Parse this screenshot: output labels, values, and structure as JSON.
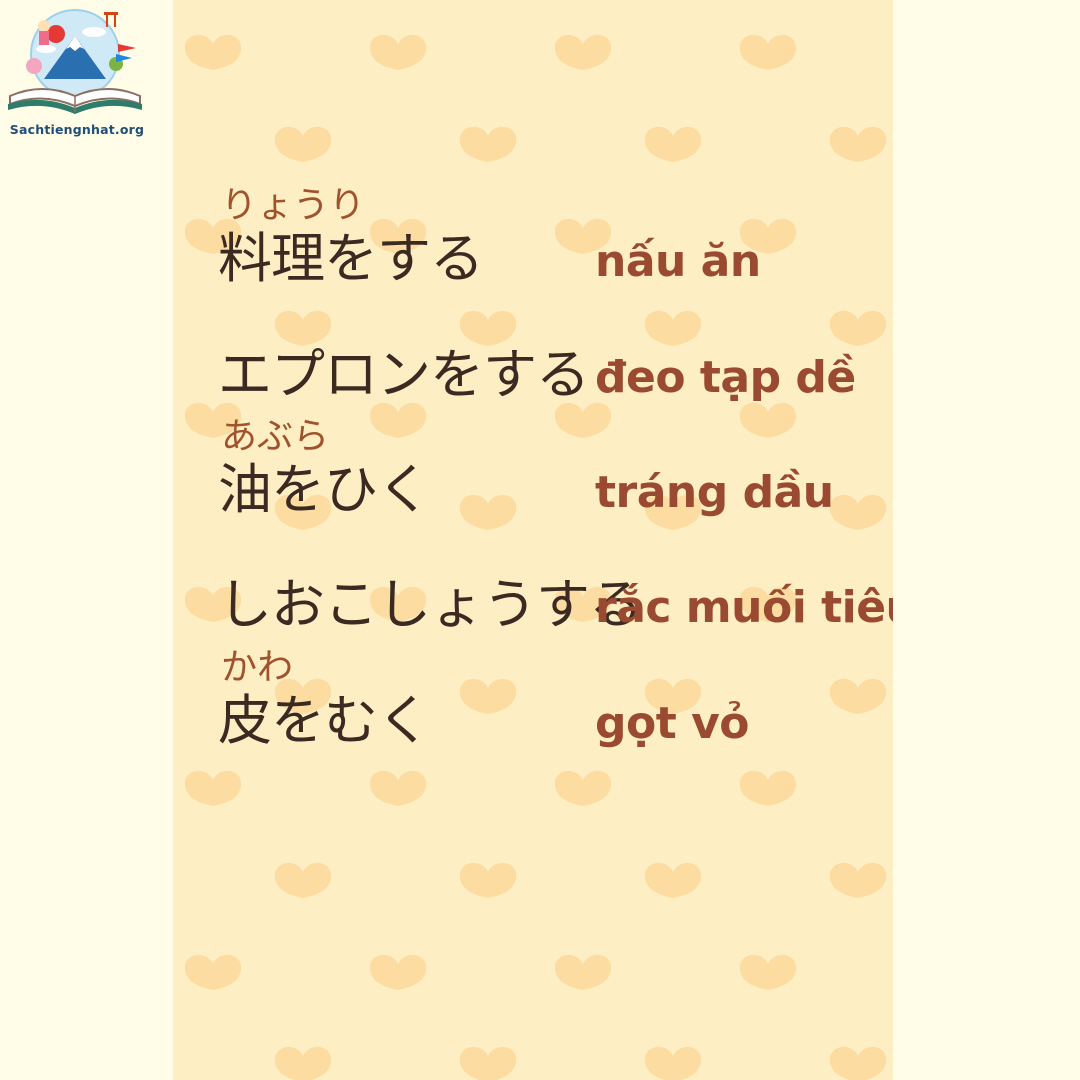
{
  "logo": {
    "text": "Sachtiengnhat.org",
    "icon": "open-book-mount-fuji-logo"
  },
  "colors": {
    "page_background": "#fffde8",
    "card_background": "#feeec4",
    "heart_pattern": "#fcdca0",
    "japanese_text": "#3a2a22",
    "reading_text": "#a0522d",
    "vietnamese_text": "#9a4a30",
    "logo_text": "#1f4e79"
  },
  "vocabulary": [
    {
      "reading": "りょうり",
      "japanese": "料理をする",
      "vietnamese": "nấu ăn"
    },
    {
      "reading": "",
      "japanese": "エプロンをする",
      "vietnamese": "đeo tạp dề"
    },
    {
      "reading": "あぶら",
      "japanese": "油をひく",
      "vietnamese": "tráng dầu"
    },
    {
      "reading": "",
      "japanese": "しおこしょうする",
      "vietnamese": "rắc muối tiêu"
    },
    {
      "reading": "かわ",
      "japanese": "皮をむく",
      "vietnamese": "gọt vỏ"
    }
  ]
}
